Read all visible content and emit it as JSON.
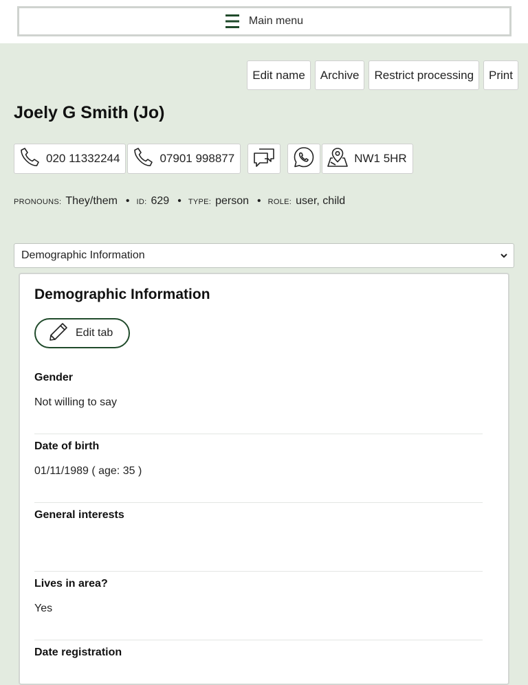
{
  "header": {
    "menu_label": "Main menu",
    "menu_icon": "hamburger-icon"
  },
  "actions": {
    "edit_name": "Edit name",
    "archive": "Archive",
    "restrict_processing": "Restrict processing",
    "print": "Print"
  },
  "person": {
    "name": "Joely G Smith (Jo)"
  },
  "contacts": {
    "phone1": "020 11332244",
    "phone2": "07901 998877",
    "postcode": "NW1 5HR"
  },
  "meta": {
    "pronouns_label": "Pronouns:",
    "pronouns_value": "They/them",
    "id_label": "ID:",
    "id_value": "629",
    "type_label": "Type:",
    "type_value": "person",
    "role_label": "Role:",
    "role_value": "user, child",
    "separator": "•"
  },
  "tab_select": {
    "selected": "Demographic Information"
  },
  "panel": {
    "title": "Demographic Information",
    "edit_tab_label": "Edit tab",
    "fields": [
      {
        "label": "Gender",
        "value": "Not willing to say"
      },
      {
        "label": "Date of birth",
        "value": "01/11/1989 ( age: 35 )"
      },
      {
        "label": "General interests",
        "value": ""
      },
      {
        "label": "Lives in area?",
        "value": "Yes"
      },
      {
        "label": "Date registration",
        "value": ""
      }
    ]
  },
  "colors": {
    "background": "#e3ebe0",
    "accent_dark_green": "#1f4a2a"
  }
}
